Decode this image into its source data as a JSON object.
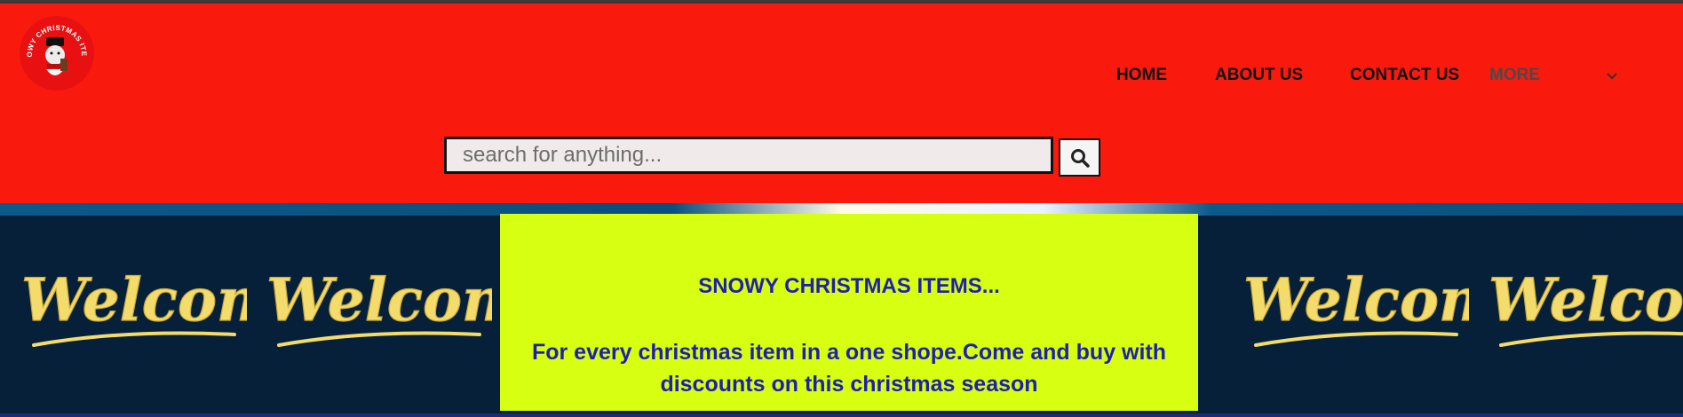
{
  "logo": {
    "icon": "snowy-christmas-logo-icon",
    "text": "SNOWY CHRISTMAS ITEMS"
  },
  "nav": {
    "items": [
      {
        "label": "HOME"
      },
      {
        "label": "ABOUT US"
      },
      {
        "label": "CONTACT US"
      },
      {
        "label": "MORE"
      }
    ],
    "more_icon": "chevron-down-icon"
  },
  "search": {
    "placeholder": "search for anything...",
    "button_icon": "search-icon"
  },
  "banner": {
    "welcome_text": "Welcome",
    "promo_title": "SNOWY CHRISTMAS ITEMS...",
    "promo_text": "For every christmas item in a one shope.Come and buy with discounts on this christmas season"
  },
  "colors": {
    "header": "#fa1a0d",
    "promo_bg": "#d6ff12",
    "promo_text": "#1f1fb0",
    "banner_bg": "#07203a",
    "welcome_fill": "#f4dc6c"
  }
}
